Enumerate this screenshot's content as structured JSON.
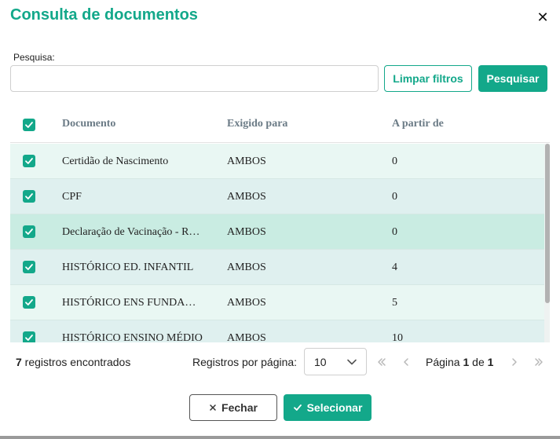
{
  "dialog": {
    "title": "Consulta de documentos",
    "close_glyph": "✕"
  },
  "search": {
    "label": "Pesquisa:",
    "value": "",
    "placeholder": "",
    "clear_label": "Limpar filtros",
    "search_label": "Pesquisar"
  },
  "table": {
    "columns": [
      "Documento",
      "Exigido para",
      "A partir de"
    ],
    "rows": [
      {
        "documento": "Certidão de Nascimento",
        "exigido": "AMBOS",
        "apartir": "0",
        "checked": true
      },
      {
        "documento": "CPF",
        "exigido": "AMBOS",
        "apartir": "0",
        "checked": true
      },
      {
        "documento": "Declaração de Vacinação - R…",
        "exigido": "AMBOS",
        "apartir": "0",
        "checked": true
      },
      {
        "documento": "HISTÓRICO ED. INFANTIL",
        "exigido": "AMBOS",
        "apartir": "4",
        "checked": true
      },
      {
        "documento": "HISTÓRICO ENS FUNDA…",
        "exigido": "AMBOS",
        "apartir": "5",
        "checked": true
      },
      {
        "documento": "HISTÓRICO ENSINO MÉDIO",
        "exigido": "AMBOS",
        "apartir": "10",
        "checked": true
      }
    ]
  },
  "footer": {
    "count": "7",
    "count_suffix": " registros encontrados",
    "rows_per_page_label": "Registros por página:",
    "rows_per_page_value": "10",
    "page_prefix": "Página ",
    "page_current": "1",
    "page_of": " de ",
    "page_total": "1"
  },
  "actions": {
    "close_label": "Fechar",
    "select_label": "Selecionar"
  },
  "colors": {
    "accent": "#13a88a",
    "row_a": "#e9f7f3",
    "row_b": "#dff0ef",
    "row_highlight": "#c9ece2"
  },
  "icons": [
    "close-icon",
    "check-icon",
    "chevron-down-icon",
    "first-page-icon",
    "prev-page-icon",
    "next-page-icon",
    "last-page-icon"
  ]
}
